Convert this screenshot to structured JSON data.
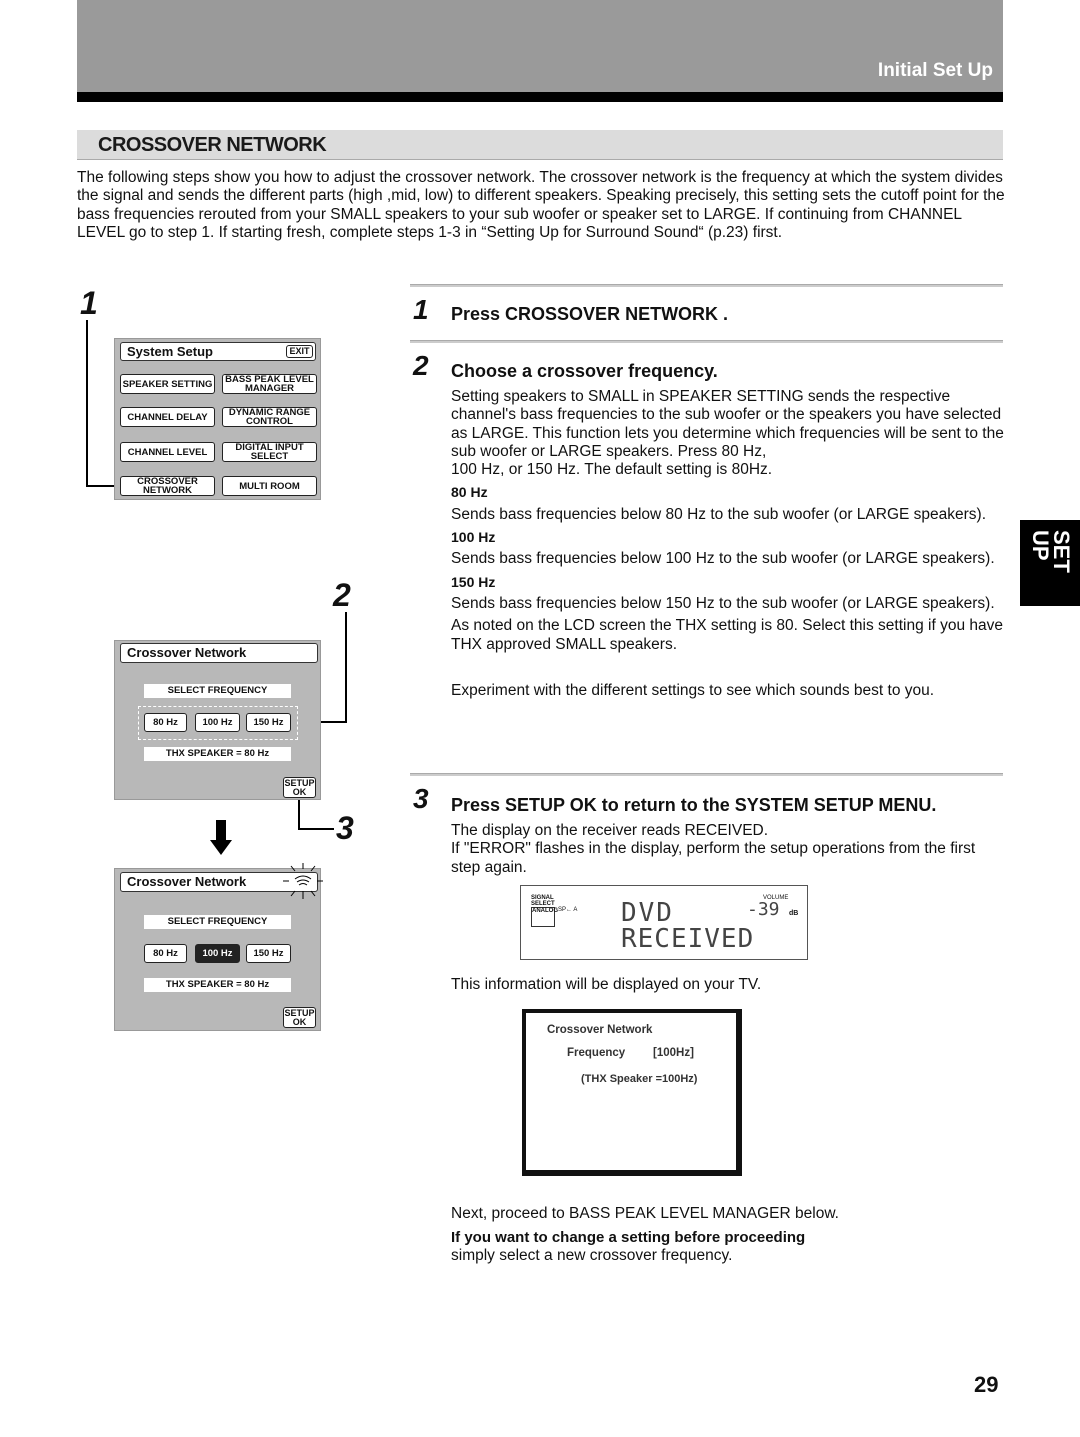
{
  "header": {
    "section": "Initial Set Up"
  },
  "title": "CROSSOVER NETWORK",
  "intro": "The following steps show you how to adjust the crossover network. The crossover network is the frequency at which the system divides the signal and sends the different parts (high ,mid, low) to different speakers. Speaking precisely, this setting sets the cutoff point for the bass frequencies rerouted from your SMALL speakers to your sub woofer or speaker set to LARGE. If continuing from CHANNEL LEVEL go to step 1. If starting fresh, complete steps 1-3 in “Setting Up for Surround Sound“ (p.23) first.",
  "left": {
    "step1": "1",
    "step2": "2",
    "step3": "3",
    "system_setup": {
      "title": "System Setup",
      "exit": "EXIT",
      "buttons": [
        "SPEAKER SETTING",
        "BASS PEAK LEVEL MANAGER",
        "CHANNEL DELAY",
        "DYNAMIC RANGE CONTROL",
        "CHANNEL LEVEL",
        "DIGITAL INPUT SELECT",
        "CROSSOVER NETWORK",
        "MULTI ROOM"
      ]
    },
    "crossover": {
      "title": "Crossover Network",
      "select": "SELECT FREQUENCY",
      "freqs": [
        "80 Hz",
        "100 Hz",
        "150 Hz"
      ],
      "thx": "THX SPEAKER = 80 Hz",
      "setup_ok": "SETUP OK",
      "selected_after": "100 Hz"
    }
  },
  "steps": [
    {
      "num": "1",
      "heading": "Press CROSSOVER NETWORK ."
    },
    {
      "num": "2",
      "heading": "Choose a crossover frequency.",
      "body": "Setting speakers to SMALL in SPEAKER SETTING sends the respective channel's bass frequencies to the sub woofer or the speakers you have selected as LARGE. This function lets you determine which frequencies will be sent to the sub woofer or LARGE speakers. Press 80 Hz,",
      "body2": "100 Hz, or 150 Hz. The default setting is 80Hz.",
      "opts": [
        {
          "label": "80 Hz",
          "text": "Sends bass frequencies below 80 Hz to the sub woofer (or LARGE speakers)."
        },
        {
          "label": "100 Hz",
          "text": "Sends bass frequencies below 100 Hz to the sub woofer (or LARGE speakers)."
        },
        {
          "label": "150 Hz",
          "text": "Sends bass frequencies below 150 Hz to the sub woofer (or LARGE speakers)."
        }
      ],
      "note": "As noted on the LCD screen the THX setting is 80. Select this setting if you have THX approved SMALL speakers.",
      "experiment": "Experiment with the different settings to see which sounds best to you."
    },
    {
      "num": "3",
      "heading": "Press SETUP OK to return to the SYSTEM SETUP MENU.",
      "body": "The display on the receiver reads RECEIVED.",
      "body2": "If \"ERROR\" flashes in the display, perform the setup operations from the first step again."
    }
  ],
  "lcd": {
    "signal_select": "SIGNAL SELECT",
    "analog": "ANALOG",
    "sp": "SP← A",
    "volume": "VOLUME",
    "line1": "DVD",
    "line2": "RECEIVED",
    "vol": "-39",
    "db": "dB"
  },
  "tv_caption": "This information will be displayed on your TV.",
  "tv": {
    "title": "Crossover Network",
    "freq_label": "Frequency",
    "freq_value": "[100Hz]",
    "thx": "(THX Speaker =100Hz)"
  },
  "next": "Next, proceed to BASS PEAK LEVEL MANAGER below.",
  "change_head": "If you want to change a setting before proceeding",
  "change_body": "simply select a new crossover frequency.",
  "side_tab": "SET UP",
  "page_number": "29"
}
